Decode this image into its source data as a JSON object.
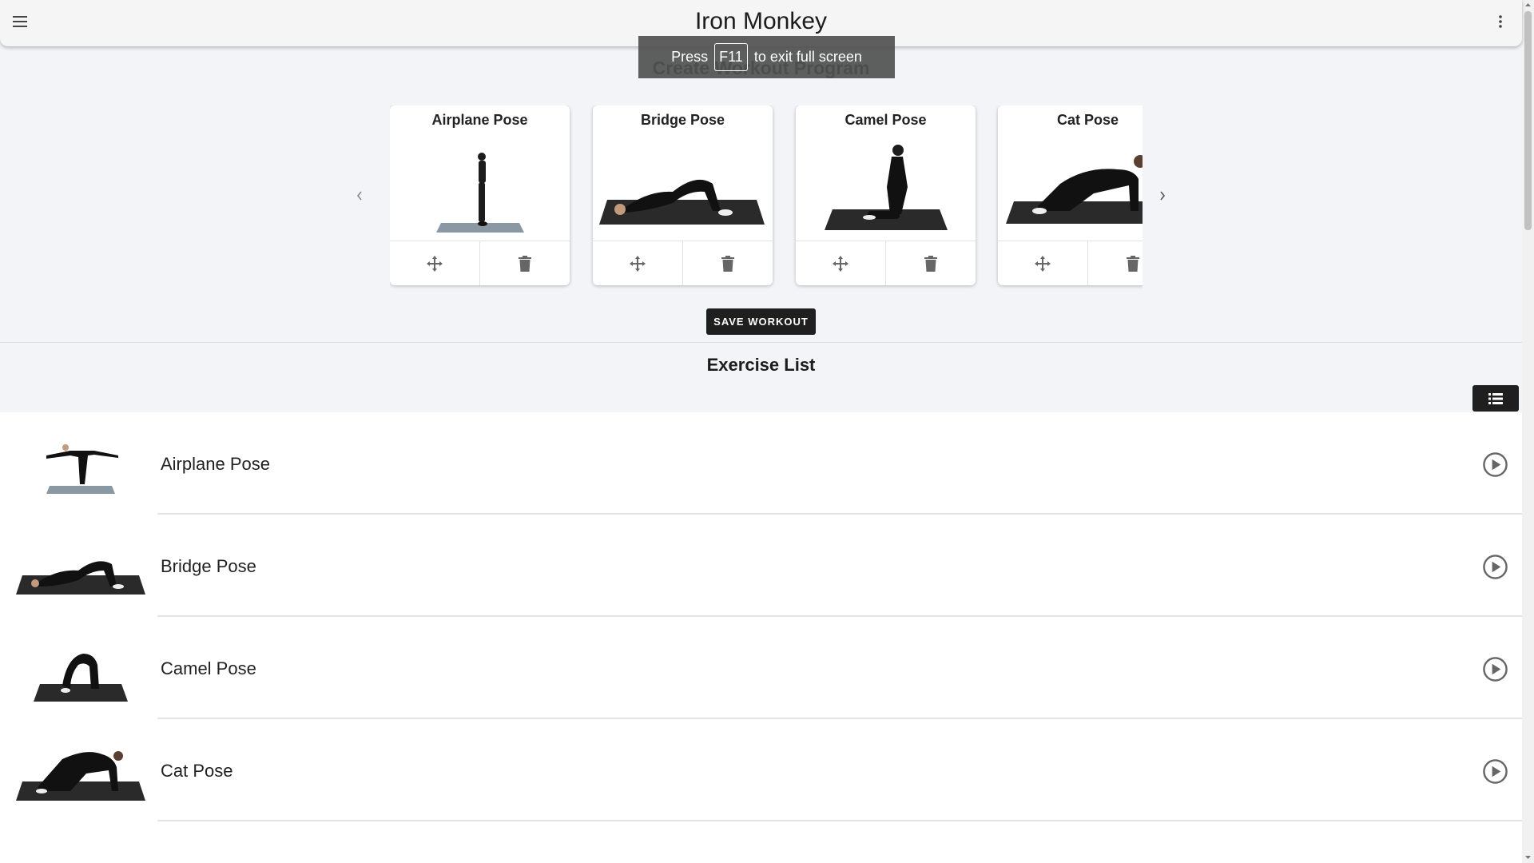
{
  "app": {
    "title": "Iron Monkey"
  },
  "toast": {
    "press": "Press",
    "key": "F11",
    "rest": "to exit full screen"
  },
  "builder": {
    "heading": "Create Workout Program",
    "save_label": "SAVE WORKOUT",
    "cards": [
      {
        "title": "Airplane Pose",
        "icon": "airplane-pose-image"
      },
      {
        "title": "Bridge Pose",
        "icon": "bridge-pose-image"
      },
      {
        "title": "Camel Pose",
        "icon": "camel-pose-image"
      },
      {
        "title": "Cat Pose",
        "icon": "cat-pose-image"
      }
    ]
  },
  "exercise_list": {
    "heading": "Exercise List",
    "items": [
      {
        "name": "Airplane Pose"
      },
      {
        "name": "Bridge Pose"
      },
      {
        "name": "Camel Pose"
      },
      {
        "name": "Cat Pose"
      }
    ]
  },
  "colors": {
    "accent": "#1f1f1f",
    "background": "#f3f4f7",
    "mat": "#2a2a2a",
    "mat_light": "#8a98a3"
  }
}
